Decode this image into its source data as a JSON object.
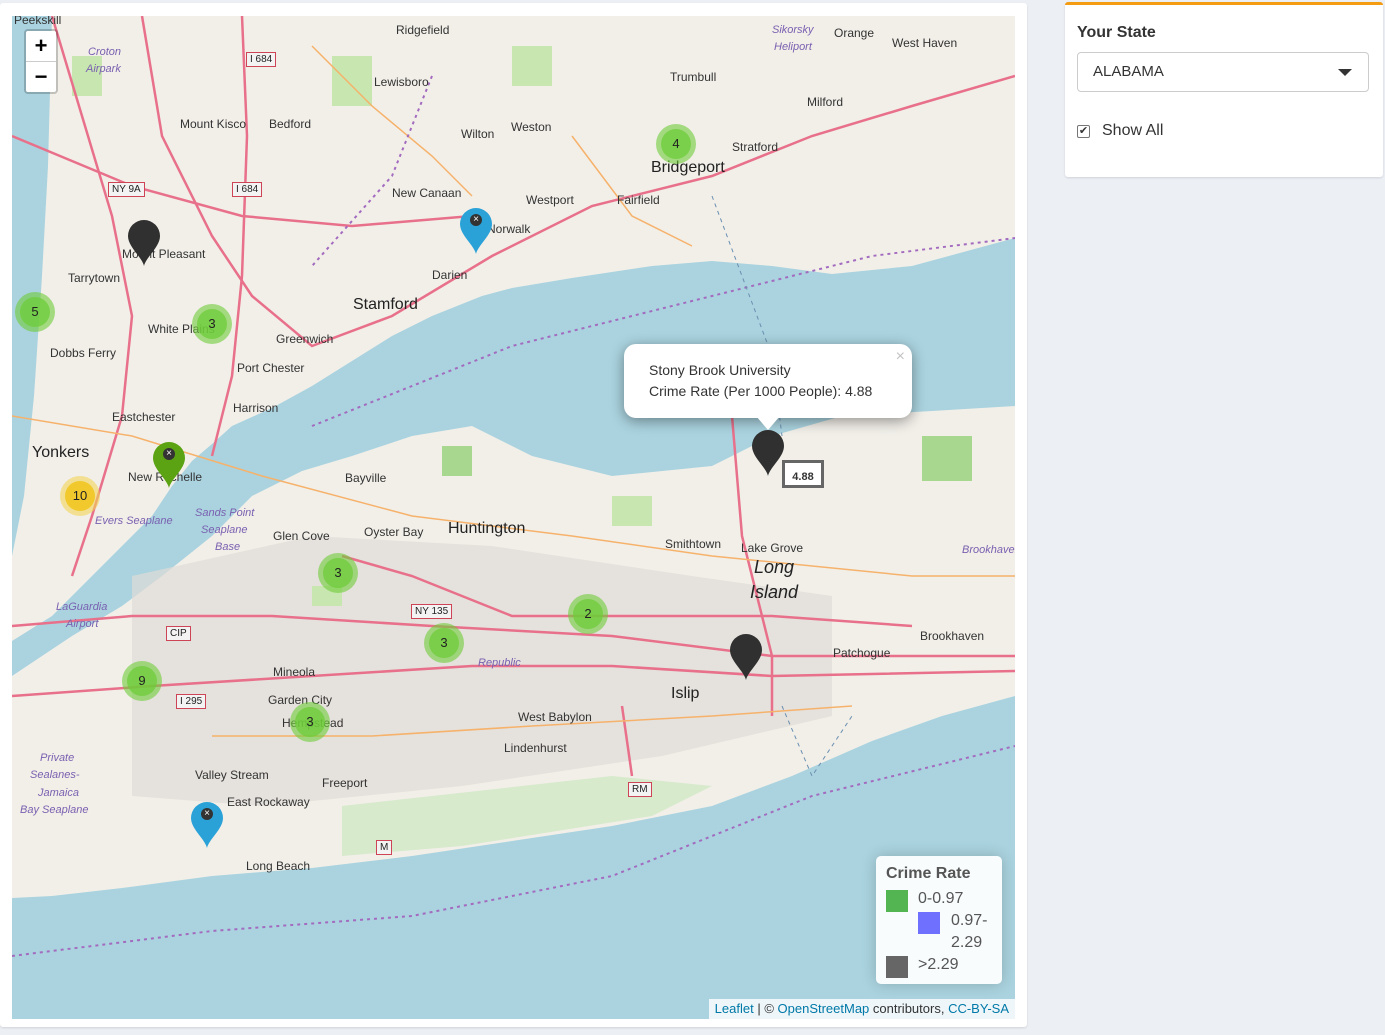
{
  "map": {
    "zoom_in": "+",
    "zoom_out": "−",
    "places": [
      {
        "text": "Peekskill",
        "cls": ""
      },
      {
        "text": "Ridgefield",
        "cls": ""
      },
      {
        "text": "Croton",
        "cls": "air"
      },
      {
        "text": "Airpark",
        "cls": "air"
      },
      {
        "text": "Lewisboro",
        "cls": ""
      },
      {
        "text": "Trumbull",
        "cls": ""
      },
      {
        "text": "Milford",
        "cls": ""
      },
      {
        "text": "Orange",
        "cls": ""
      },
      {
        "text": "West Haven",
        "cls": ""
      },
      {
        "text": "Sikorsky",
        "cls": "air"
      },
      {
        "text": "Heliport",
        "cls": "air"
      },
      {
        "text": "Mount Kisco",
        "cls": ""
      },
      {
        "text": "Bedford",
        "cls": ""
      },
      {
        "text": "Wilton",
        "cls": ""
      },
      {
        "text": "Weston",
        "cls": ""
      },
      {
        "text": "Stratford",
        "cls": ""
      },
      {
        "text": "Bridgeport",
        "cls": "big"
      },
      {
        "text": "New Canaan",
        "cls": ""
      },
      {
        "text": "Westport",
        "cls": ""
      },
      {
        "text": "Fairfield",
        "cls": ""
      },
      {
        "text": "Norwalk",
        "cls": ""
      },
      {
        "text": "Mount Pleasant",
        "cls": ""
      },
      {
        "text": "Tarrytown",
        "cls": ""
      },
      {
        "text": "Darien",
        "cls": ""
      },
      {
        "text": "Stamford",
        "cls": "big"
      },
      {
        "text": "White Plains",
        "cls": ""
      },
      {
        "text": "Greenwich",
        "cls": ""
      },
      {
        "text": "Dobbs Ferry",
        "cls": ""
      },
      {
        "text": "Port Chester",
        "cls": ""
      },
      {
        "text": "Harrison",
        "cls": ""
      },
      {
        "text": "Eastchester",
        "cls": ""
      },
      {
        "text": "Yonkers",
        "cls": "big"
      },
      {
        "text": "New Rochelle",
        "cls": ""
      },
      {
        "text": "Bayville",
        "cls": ""
      },
      {
        "text": "Sands Point",
        "cls": "air"
      },
      {
        "text": "Seaplane",
        "cls": "air"
      },
      {
        "text": "Base",
        "cls": "air"
      },
      {
        "text": "Evers Seaplane",
        "cls": "air"
      },
      {
        "text": "Glen Cove",
        "cls": ""
      },
      {
        "text": "Oyster Bay",
        "cls": ""
      },
      {
        "text": "Huntington",
        "cls": "big"
      },
      {
        "text": "Smithtown",
        "cls": ""
      },
      {
        "text": "Lake Grove",
        "cls": ""
      },
      {
        "text": "Long",
        "cls": "island"
      },
      {
        "text": "Island",
        "cls": "island"
      },
      {
        "text": "Brookhaven",
        "cls": ""
      },
      {
        "text": "Patchogue",
        "cls": ""
      },
      {
        "text": "LaGuardia",
        "cls": "air"
      },
      {
        "text": "Airport",
        "cls": "air"
      },
      {
        "text": "Mineola",
        "cls": ""
      },
      {
        "text": "Garden City",
        "cls": ""
      },
      {
        "text": "Hempstead",
        "cls": ""
      },
      {
        "text": "Republic",
        "cls": "air"
      },
      {
        "text": "Islip",
        "cls": "big"
      },
      {
        "text": "West Babylon",
        "cls": ""
      },
      {
        "text": "Lindenhurst",
        "cls": ""
      },
      {
        "text": "Valley Stream",
        "cls": ""
      },
      {
        "text": "Freeport",
        "cls": ""
      },
      {
        "text": "East Rockaway",
        "cls": ""
      },
      {
        "text": "Long Beach",
        "cls": ""
      },
      {
        "text": "Private",
        "cls": "air"
      },
      {
        "text": "Sealanes-",
        "cls": "air"
      },
      {
        "text": "Jamaica",
        "cls": "air"
      },
      {
        "text": "Bay Seaplane",
        "cls": "air"
      },
      {
        "text": "Brookhaven",
        "cls": "air"
      }
    ],
    "shields": [
      "I 684",
      "NY 9A",
      "I 684",
      "NY 135",
      "CIP",
      "I 295",
      "RM",
      "M"
    ],
    "clusters": [
      {
        "count": "4",
        "color": "green"
      },
      {
        "count": "5",
        "color": "green"
      },
      {
        "count": "3",
        "color": "green"
      },
      {
        "count": "10",
        "color": "yellow"
      },
      {
        "count": "3",
        "color": "green"
      },
      {
        "count": "2",
        "color": "green"
      },
      {
        "count": "3",
        "color": "green"
      },
      {
        "count": "9",
        "color": "green"
      },
      {
        "count": "3",
        "color": "green"
      }
    ],
    "markers": [
      {
        "color": "#303030",
        "symbol": ""
      },
      {
        "color": "#2aa2d8",
        "symbol": "×"
      },
      {
        "color": "#5ca314",
        "symbol": "×"
      },
      {
        "color": "#303030",
        "symbol": ""
      },
      {
        "color": "#303030",
        "symbol": ""
      },
      {
        "color": "#2aa2d8",
        "symbol": "×"
      }
    ],
    "popup": {
      "line1": "Stony Brook University",
      "line2": "Crime Rate (Per 1000 People): 4.88",
      "close": "×"
    },
    "marker_label": "4.88",
    "legend": {
      "title": "Crime Rate",
      "items": [
        {
          "label": "0-0.97",
          "color": "#52b552"
        },
        {
          "label": "0.97-",
          "label2": "2.29",
          "color": "#7070ff"
        },
        {
          "label": ">2.29",
          "color": "#666666"
        }
      ]
    },
    "attribution": {
      "leaflet": "Leaflet",
      "sep": " | © ",
      "osm": "OpenStreetMap",
      "contrib": " contributors, ",
      "license": "CC-BY-SA"
    }
  },
  "sidebar": {
    "label": "Your State",
    "select_value": "ALABAMA",
    "checkbox_checked": true,
    "checkbox_label": "Show All"
  }
}
